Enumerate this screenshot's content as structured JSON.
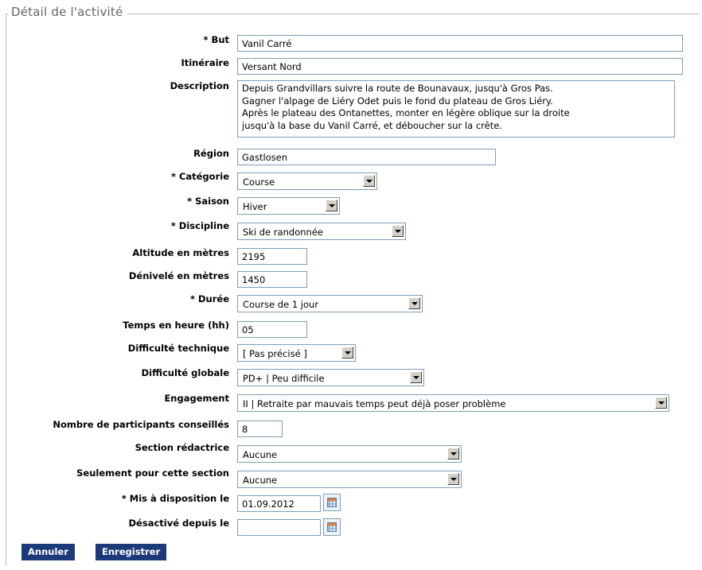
{
  "section": {
    "legend": "Détail de l'activité"
  },
  "fields": {
    "but": {
      "label": "* But",
      "value": "Vanil Carré"
    },
    "itineraire": {
      "label": "Itinéraire",
      "value": "Versant Nord"
    },
    "description": {
      "label": "Description",
      "lines": [
        "Depuis Grandvillars suivre la route de Bounavaux, jusqu'à Gros Pas.",
        "Gagner l'alpage de Liéry Odet puis le fond du plateau de Gros Liéry.",
        "Après le plateau des Ontanettes, monter en légère oblique sur la droite",
        "jusqu'à la base du Vanil Carré, et déboucher sur la crête."
      ]
    },
    "region": {
      "label": "Région",
      "value": "Gastlosen"
    },
    "categorie": {
      "label": "* Catégorie",
      "value": "Course"
    },
    "saison": {
      "label": "* Saison",
      "value": "Hiver"
    },
    "discipline": {
      "label": "* Discipline",
      "value": "Ski de randonnée"
    },
    "altitude": {
      "label": "Altitude en mètres",
      "value": "2195"
    },
    "denivele": {
      "label": "Dénivelé en mètres",
      "value": "1450"
    },
    "duree": {
      "label": "* Durée",
      "value": "Course de 1 jour"
    },
    "temps": {
      "label": "Temps en heure (hh)",
      "value": "05"
    },
    "diff_tech": {
      "label": "Difficulté technique",
      "value": "[ Pas précisé ]"
    },
    "diff_glob": {
      "label": "Difficulté globale",
      "value": "PD+ | Peu difficile"
    },
    "engagement": {
      "label": "Engagement",
      "value": "II | Retraite par mauvais temps peut déjà poser problème"
    },
    "participants": {
      "label": "Nombre de participants conseillés",
      "value": "8"
    },
    "section_red": {
      "label": "Section rédactrice",
      "value": "Aucune"
    },
    "seulement": {
      "label": "Seulement pour cette section",
      "value": "Aucune"
    },
    "mis_dispo": {
      "label": "* Mis à disposition le",
      "value": "01.09.2012"
    },
    "desactive": {
      "label": "Désactivé depuis le",
      "value": ""
    }
  },
  "buttons": {
    "cancel": "Annuler",
    "save": "Enregistrer"
  },
  "colors": {
    "button_bg": "#1c3a7a",
    "input_border": "#7f9db9",
    "legend_text": "#666666"
  }
}
